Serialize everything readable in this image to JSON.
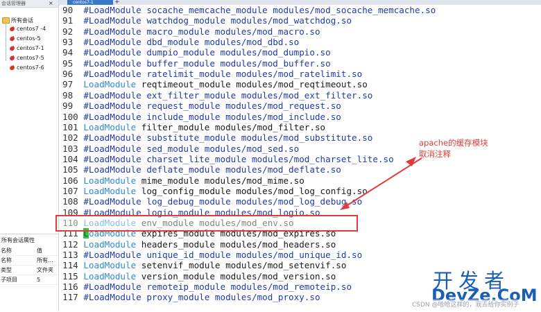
{
  "left_panel": {
    "header_label": "会话管理器",
    "close_glyph": "×",
    "tree": {
      "root_label": "所有会话",
      "sessions": [
        "centos7 -4",
        "centos-5",
        "centos7-1",
        "centos7-5",
        "centos7-6"
      ]
    },
    "properties": {
      "title": "所有会话属性",
      "rows": [
        {
          "name": "名称",
          "value": "值"
        },
        {
          "name": "名称",
          "value": "所有..."
        },
        {
          "name": "类型",
          "value": "文件夹"
        },
        {
          "name": "子项目",
          "value": "5"
        }
      ]
    }
  },
  "tabs": {
    "active_label": "centos7-1",
    "add_glyph": "+"
  },
  "terminal": {
    "lines": [
      {
        "num": "90",
        "kw": "#LoadModule",
        "rest": " socache_memcache_module modules/mod_socache_memcache.so"
      },
      {
        "num": "91",
        "kw": "#LoadModule",
        "rest": " watchdog_module modules/mod_watchdog.so"
      },
      {
        "num": "92",
        "kw": "#LoadModule",
        "rest": " macro_module modules/mod_macro.so"
      },
      {
        "num": "93",
        "kw": "#LoadModule",
        "rest": " dbd_module modules/mod_dbd.so"
      },
      {
        "num": "94",
        "kw": "#LoadModule",
        "rest": " dumpio_module modules/mod_dumpio.so"
      },
      {
        "num": "95",
        "kw": "#LoadModule",
        "rest": " buffer_module modules/mod_buffer.so"
      },
      {
        "num": "96",
        "kw": "#LoadModule",
        "rest": " ratelimit_module modules/mod_ratelimit.so"
      },
      {
        "num": "97",
        "kw": "LoadModule",
        "rest": " reqtimeout_module modules/mod_reqtimeout.so"
      },
      {
        "num": "98",
        "kw": "#LoadModule",
        "rest": " ext_filter_module modules/mod_ext_filter.so"
      },
      {
        "num": "99",
        "kw": "#LoadModule",
        "rest": " request_module modules/mod_request.so"
      },
      {
        "num": "100",
        "kw": "#LoadModule",
        "rest": " include_module modules/mod_include.so"
      },
      {
        "num": "101",
        "kw": "LoadModule",
        "rest": " filter_module modules/mod_filter.so"
      },
      {
        "num": "102",
        "kw": "#LoadModule",
        "rest": " substitute_module modules/mod_substitute.so"
      },
      {
        "num": "103",
        "kw": "#LoadModule",
        "rest": " sed_module modules/mod_sed.so"
      },
      {
        "num": "104",
        "kw": "#LoadModule",
        "rest": " charset_lite_module modules/mod_charset_lite.so"
      },
      {
        "num": "105",
        "kw": "#LoadModule",
        "rest": " deflate_module modules/mod_deflate.so"
      },
      {
        "num": "106",
        "kw": "LoadModule",
        "rest": " mime_module modules/mod_mime.so"
      },
      {
        "num": "107",
        "kw": "LoadModule",
        "rest": " log_config_module modules/mod_log_config.so"
      },
      {
        "num": "108",
        "kw": "#LoadModule",
        "rest": " log_debug_module modules/mod_log_debug.so"
      },
      {
        "num": "109",
        "kw": "#LoadModule",
        "rest": " logio_module modules/mod_logio.so"
      },
      {
        "num": "110",
        "kw": "LoadModule",
        "rest": " env_module modules/mod_env.so"
      },
      {
        "num": "111",
        "kw": "LoadModule",
        "rest": " expires_module modules/mod_expires.so"
      },
      {
        "num": "112",
        "kw": "LoadModule",
        "rest": " headers_module modules/mod_headers.so"
      },
      {
        "num": "113",
        "kw": "#LoadModule",
        "rest": " unique_id_module modules/mod_unique_id.so"
      },
      {
        "num": "114",
        "kw": "LoadModule",
        "rest": " setenvif_module modules/mod_setenvif.so"
      },
      {
        "num": "115",
        "kw": "LoadModule",
        "rest": " version_module modules/mod_version.so"
      },
      {
        "num": "116",
        "kw": "#LoadModule",
        "rest": " remoteip_module modules/mod_remoteip.so"
      },
      {
        "num": "117",
        "kw": "#LoadModule",
        "rest": " proxy_module modules/mod_proxy.so"
      }
    ]
  },
  "annotation": {
    "line1": "apache的缓存模块",
    "line2": "取消注释",
    "color": "#e03c3c"
  },
  "watermark": {
    "cn": "开发者",
    "en": "DevZe.CoM",
    "credit": "CSDN @哈哈这样的，我去给你实例子"
  }
}
